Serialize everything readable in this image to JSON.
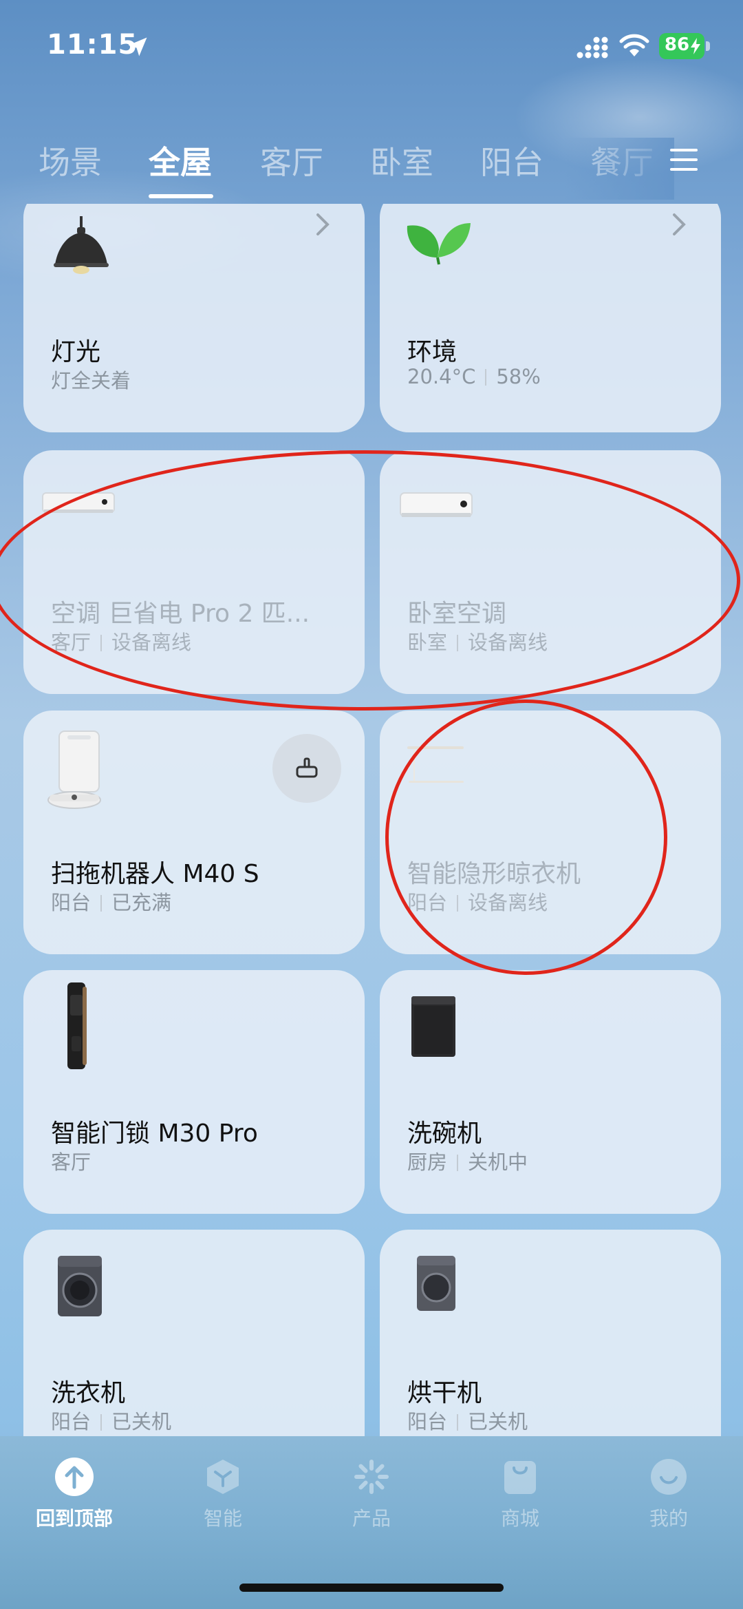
{
  "status_bar": {
    "time": "11:15",
    "battery": "86"
  },
  "tabs": [
    {
      "label": "场景"
    },
    {
      "label": "全屋"
    },
    {
      "label": "客厅"
    },
    {
      "label": "卧室"
    },
    {
      "label": "阳台"
    },
    {
      "label": "餐厅"
    }
  ],
  "cards": {
    "light": {
      "name": "灯光",
      "sub": "灯全关着"
    },
    "env": {
      "name": "环境",
      "temp": "20.4°C",
      "humidity": "58%"
    },
    "ac_living": {
      "name": "空调 巨省电 Pro 2 匹...",
      "room": "客厅",
      "status": "设备离线"
    },
    "ac_bedroom": {
      "name": "卧室空调",
      "room": "卧室",
      "status": "设备离线"
    },
    "robot": {
      "name": "扫拖机器人 M40 S",
      "room": "阳台",
      "status": "已充满"
    },
    "hanger": {
      "name": "智能隐形晾衣机",
      "room": "阳台",
      "status": "设备离线"
    },
    "lock": {
      "name": "智能门锁 M30 Pro",
      "room": "客厅"
    },
    "dishwasher": {
      "name": "洗碗机",
      "room": "厨房",
      "status": "关机中"
    },
    "washer": {
      "name": "洗衣机",
      "room": "阳台",
      "status": "已关机"
    },
    "dryer": {
      "name": "烘干机",
      "room": "阳台",
      "status": "已关机"
    }
  },
  "bottom_nav": [
    {
      "label": "回到顶部",
      "icon": "arrow-up-icon"
    },
    {
      "label": "智能",
      "icon": "cube-icon"
    },
    {
      "label": "产品",
      "icon": "sparkle-icon"
    },
    {
      "label": "商城",
      "icon": "bag-icon"
    },
    {
      "label": "我的",
      "icon": "smile-icon"
    }
  ],
  "colors": {
    "accent": "#34c759",
    "annotation": "#e0251b"
  }
}
